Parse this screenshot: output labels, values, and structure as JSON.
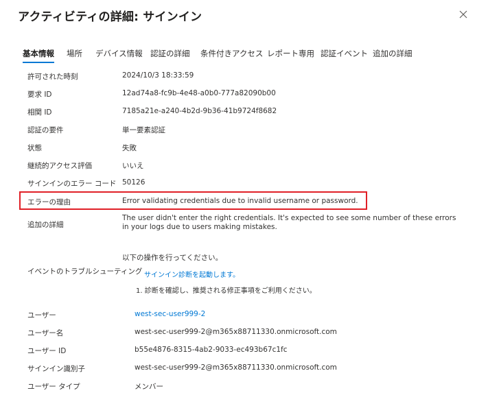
{
  "header": {
    "title": "アクティビティの詳細: サインイン"
  },
  "tabs": [
    {
      "label": "基本情報",
      "active": true
    },
    {
      "label": "場所"
    },
    {
      "label": "デバイス情報"
    },
    {
      "label": "認証の詳細"
    },
    {
      "label": "条件付きアクセス"
    },
    {
      "label": "レポート専用"
    },
    {
      "label": "認証イベント"
    },
    {
      "label": "追加の詳細"
    }
  ],
  "details": {
    "time_label": "許可された時刻",
    "time_value": "2024/10/3 18:33:59",
    "request_id_label": "要求 ID",
    "request_id_value": "12ad74a8-fc9b-4e48-a0b0-777a82090b00",
    "correlation_id_label": "相関 ID",
    "correlation_id_value": "7185a21e-a240-4b2d-9b36-41b9724f8682",
    "auth_req_label": "認証の要件",
    "auth_req_value": "単一要素認証",
    "status_label": "状態",
    "status_value": "失敗",
    "cae_label": "継続的アクセス評価",
    "cae_value": "いいえ",
    "error_code_label": "サインインのエラー コード",
    "error_code_value": "50126",
    "failure_reason_label": "エラーの理由",
    "failure_reason_value": "Error validating credentials due to invalid username or password.",
    "additional_label": "追加の詳細",
    "additional_line1": "The user didn't enter the right credentials.  It's expected to see some number of these errors",
    "additional_line2": "in your logs due to users making mistakes.",
    "troubleshoot_label": "イベントのトラブルシューティング",
    "troubleshoot_intro": "以下の操作を行ってください。",
    "troubleshoot_link": "サインイン診断を起動します。",
    "troubleshoot_step": "1. 診断を確認し、推奨される修正事項をご利用ください。",
    "user_label": "ユーザー",
    "user_value": "west-sec-user999-2",
    "username_label": "ユーザー名",
    "username_value": "west-sec-user999-2@m365x88711330.onmicrosoft.com",
    "userid_label": "ユーザー ID",
    "userid_value": "b55e4876-8315-4ab2-9033-ec493b67c1fc",
    "signin_id_label": "サインイン識別子",
    "signin_id_value": "west-sec-user999-2@m365x88711330.onmicrosoft.com",
    "usertype_label": "ユーザー タイプ",
    "usertype_value": "メンバー"
  }
}
